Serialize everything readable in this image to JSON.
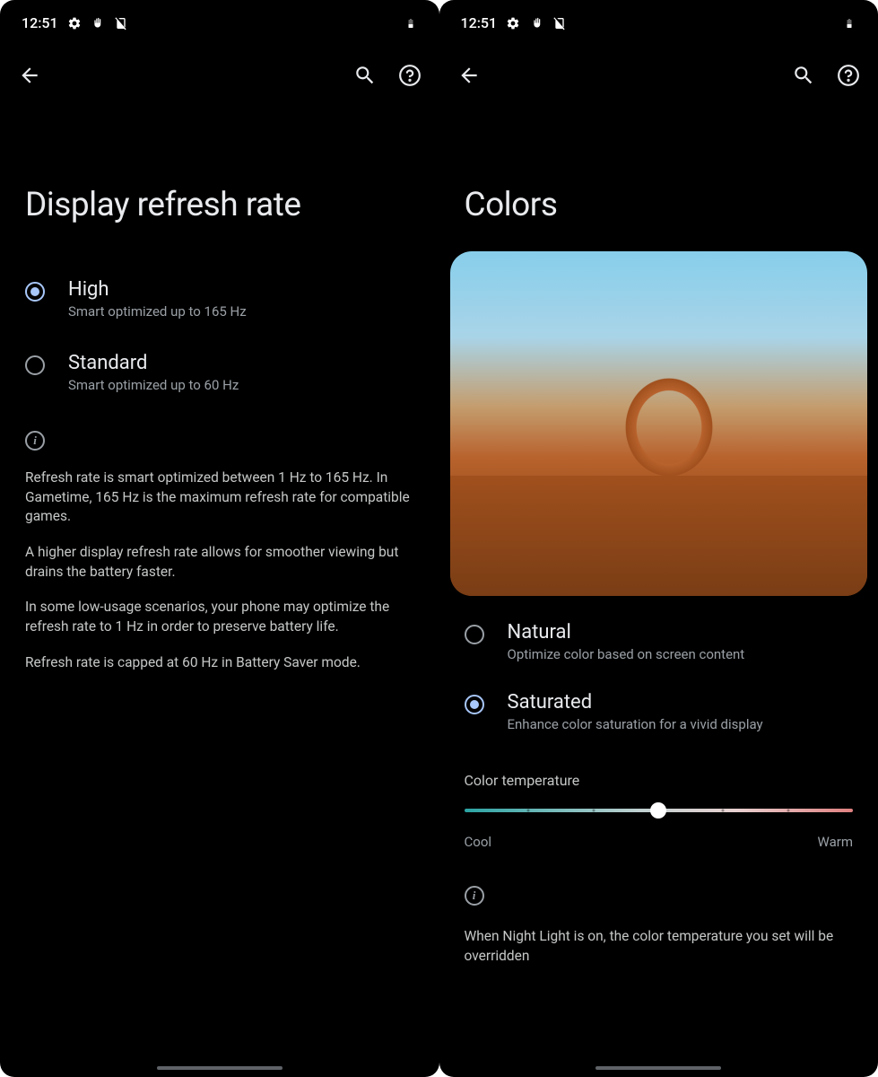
{
  "status": {
    "time": "12:51"
  },
  "left": {
    "title": "Display refresh rate",
    "options": [
      {
        "title": "High",
        "subtitle": "Smart optimized up to 165 Hz",
        "selected": true
      },
      {
        "title": "Standard",
        "subtitle": "Smart optimized up to 60 Hz",
        "selected": false
      }
    ],
    "info": [
      "Refresh rate is smart optimized between 1 Hz to 165 Hz. In Gametime, 165 Hz is the maximum refresh rate for compatible games.",
      "A higher display refresh rate allows for smoother viewing but drains the battery faster.",
      "In some low-usage scenarios, your phone may optimize the refresh rate to 1 Hz in order to preserve battery life.",
      "Refresh rate is capped at 60 Hz in Battery Saver mode."
    ]
  },
  "right": {
    "title": "Colors",
    "options": [
      {
        "title": "Natural",
        "subtitle": "Optimize color based on screen content",
        "selected": false
      },
      {
        "title": "Saturated",
        "subtitle": "Enhance color saturation for a vivid display",
        "selected": true
      }
    ],
    "temperature": {
      "label": "Color temperature",
      "cool": "Cool",
      "warm": "Warm"
    },
    "info": "When Night Light is on, the color temperature you set will be overridden"
  }
}
